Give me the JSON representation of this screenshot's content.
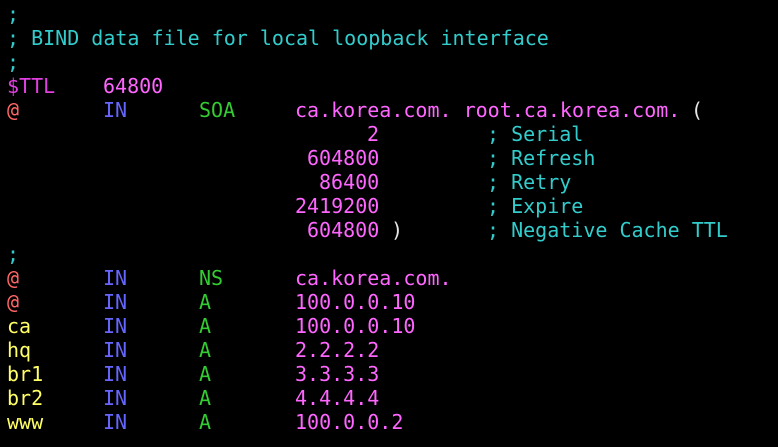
{
  "editor": {
    "lines": [
      {
        "id": "c1",
        "tokens": [
          {
            "cls": "comment",
            "col": 0,
            "text": ";"
          }
        ]
      },
      {
        "id": "c2",
        "tokens": [
          {
            "cls": "comment",
            "col": 0,
            "text": "; BIND data file for local loopback interface"
          }
        ]
      },
      {
        "id": "c3",
        "tokens": [
          {
            "cls": "comment",
            "col": 0,
            "text": ";"
          }
        ]
      },
      {
        "id": "ttl",
        "tokens": [
          {
            "cls": "variable",
            "col": 0,
            "text": "$TTL"
          },
          {
            "cls": "number",
            "col": 8,
            "text": "64800"
          }
        ]
      },
      {
        "id": "soa",
        "tokens": [
          {
            "cls": "at",
            "col": 0,
            "text": "@"
          },
          {
            "cls": "klass",
            "col": 8,
            "text": "IN"
          },
          {
            "cls": "rtype",
            "col": 16,
            "text": "SOA"
          },
          {
            "cls": "data",
            "col": 24,
            "text": "ca.korea.com. root.ca.korea.com."
          },
          {
            "cls": "punct",
            "col": 57,
            "text": "("
          }
        ]
      },
      {
        "id": "serial",
        "tokens": [
          {
            "cls": "data",
            "col": 30,
            "text": "2"
          },
          {
            "cls": "comment",
            "col": 40,
            "text": "; Serial"
          }
        ]
      },
      {
        "id": "refresh",
        "tokens": [
          {
            "cls": "data",
            "col": 25,
            "text": "604800"
          },
          {
            "cls": "comment",
            "col": 40,
            "text": "; Refresh"
          }
        ]
      },
      {
        "id": "retry",
        "tokens": [
          {
            "cls": "data",
            "col": 26,
            "text": "86400"
          },
          {
            "cls": "comment",
            "col": 40,
            "text": "; Retry"
          }
        ]
      },
      {
        "id": "expire",
        "tokens": [
          {
            "cls": "data",
            "col": 24,
            "text": "2419200"
          },
          {
            "cls": "comment",
            "col": 40,
            "text": "; Expire"
          }
        ]
      },
      {
        "id": "negttl",
        "tokens": [
          {
            "cls": "data",
            "col": 25,
            "text": "604800"
          },
          {
            "cls": "punct",
            "col": 32,
            "text": ")"
          },
          {
            "cls": "comment",
            "col": 40,
            "text": "; Negative Cache TTL"
          }
        ]
      },
      {
        "id": "c4",
        "tokens": [
          {
            "cls": "comment",
            "col": 0,
            "text": ";"
          }
        ]
      },
      {
        "id": "ns",
        "tokens": [
          {
            "cls": "at",
            "col": 0,
            "text": "@"
          },
          {
            "cls": "klass",
            "col": 8,
            "text": "IN"
          },
          {
            "cls": "rtype",
            "col": 16,
            "text": "NS"
          },
          {
            "cls": "data",
            "col": 24,
            "text": "ca.korea.com."
          }
        ]
      },
      {
        "id": "a-at",
        "tokens": [
          {
            "cls": "at",
            "col": 0,
            "text": "@"
          },
          {
            "cls": "klass",
            "col": 8,
            "text": "IN"
          },
          {
            "cls": "rtype",
            "col": 16,
            "text": "A"
          },
          {
            "cls": "data",
            "col": 24,
            "text": "100.0.0.10"
          }
        ]
      },
      {
        "id": "a-ca",
        "tokens": [
          {
            "cls": "host",
            "col": 0,
            "text": "ca"
          },
          {
            "cls": "klass",
            "col": 8,
            "text": "IN"
          },
          {
            "cls": "rtype",
            "col": 16,
            "text": "A"
          },
          {
            "cls": "data",
            "col": 24,
            "text": "100.0.0.10"
          }
        ]
      },
      {
        "id": "a-hq",
        "tokens": [
          {
            "cls": "host",
            "col": 0,
            "text": "hq"
          },
          {
            "cls": "klass",
            "col": 8,
            "text": "IN"
          },
          {
            "cls": "rtype",
            "col": 16,
            "text": "A"
          },
          {
            "cls": "data",
            "col": 24,
            "text": "2.2.2.2"
          }
        ]
      },
      {
        "id": "a-br1",
        "tokens": [
          {
            "cls": "host",
            "col": 0,
            "text": "br1"
          },
          {
            "cls": "klass",
            "col": 8,
            "text": "IN"
          },
          {
            "cls": "rtype",
            "col": 16,
            "text": "A"
          },
          {
            "cls": "data",
            "col": 24,
            "text": "3.3.3.3"
          }
        ]
      },
      {
        "id": "a-br2",
        "tokens": [
          {
            "cls": "host",
            "col": 0,
            "text": "br2"
          },
          {
            "cls": "klass",
            "col": 8,
            "text": "IN"
          },
          {
            "cls": "rtype",
            "col": 16,
            "text": "A"
          },
          {
            "cls": "data",
            "col": 24,
            "text": "4.4.4.4"
          }
        ]
      },
      {
        "id": "a-www",
        "tokens": [
          {
            "cls": "host",
            "col": 0,
            "text": "www"
          },
          {
            "cls": "klass",
            "col": 8,
            "text": "IN"
          },
          {
            "cls": "rtype",
            "col": 16,
            "text": "A"
          },
          {
            "cls": "data",
            "col": 24,
            "text": "100.0.0.2"
          }
        ]
      }
    ]
  },
  "colors": {
    "background": "#000000",
    "comment": "#33cccc",
    "variable": "#e040e0",
    "number": "#ff66ff",
    "at_symbol": "#ff6666",
    "class": "#6666ff",
    "record_type": "#33cc33",
    "record_data": "#ff66ff",
    "hostname": "#ffff66"
  }
}
